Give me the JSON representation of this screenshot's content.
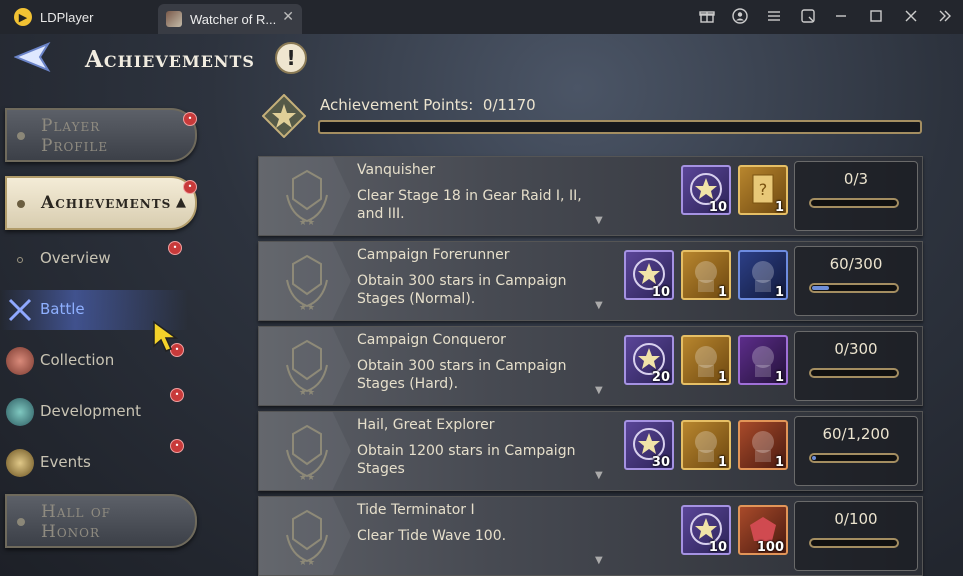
{
  "window": {
    "app_name": "LDPlayer",
    "tab_title": "Watcher of R...",
    "controls": [
      "gift-icon",
      "account-icon",
      "menu-icon",
      "screenshot-icon",
      "minimize-icon",
      "maximize-icon",
      "close-icon",
      "collapse-icon"
    ]
  },
  "header": {
    "title": "Achievements",
    "info_symbol": "!"
  },
  "sidebar": {
    "player_profile": "Player Profile",
    "achievements": "Achievements",
    "achievements_arrow": "▲",
    "subitems": [
      {
        "label": "Overview"
      },
      {
        "label": "Battle"
      },
      {
        "label": "Collection"
      },
      {
        "label": "Development"
      },
      {
        "label": "Events"
      }
    ],
    "hall_of_honor": "Hall of Honor"
  },
  "points": {
    "label": "Achievement Points:",
    "value": "0/1170"
  },
  "achievements": [
    {
      "title": "Vanquisher",
      "desc": "Clear Stage 18 in Gear Raid I, II, and III.",
      "progress": "0/3",
      "fraction": 0,
      "rewards": [
        {
          "type": "achievement-points-icon",
          "color": "purple",
          "qty": "10"
        },
        {
          "type": "mystery-card-icon",
          "color": "gold",
          "qty": "1"
        }
      ]
    },
    {
      "title": "Campaign Forerunner",
      "desc": "Obtain 300 stars in Campaign Stages (Normal).",
      "progress": "60/300",
      "fraction": 0.2,
      "rewards": [
        {
          "type": "achievement-points-icon",
          "color": "purple",
          "qty": "10"
        },
        {
          "type": "golden-hero-icon",
          "color": "gold",
          "qty": "1"
        },
        {
          "type": "dark-warrior-icon",
          "color": "blue",
          "qty": "1"
        }
      ]
    },
    {
      "title": "Campaign Conqueror",
      "desc": "Obtain 300 stars in Campaign Stages (Hard).",
      "progress": "0/300",
      "fraction": 0,
      "rewards": [
        {
          "type": "achievement-points-icon",
          "color": "purple",
          "qty": "20"
        },
        {
          "type": "golden-hero-icon",
          "color": "gold",
          "qty": "1"
        },
        {
          "type": "dark-armor-icon",
          "color": "violet",
          "qty": "1"
        }
      ]
    },
    {
      "title": "Hail, Great Explorer",
      "desc": "Obtain 1200 stars in Campaign Stages",
      "progress": "60/1,200",
      "fraction": 0.05,
      "rewards": [
        {
          "type": "achievement-points-icon",
          "color": "purple",
          "qty": "30"
        },
        {
          "type": "golden-relic-icon",
          "color": "gold",
          "qty": "1"
        },
        {
          "type": "crimson-demon-icon",
          "color": "red",
          "qty": "1"
        }
      ]
    },
    {
      "title": "Tide Terminator I",
      "desc": "Clear Tide Wave 100.",
      "progress": "0/100",
      "fraction": 0,
      "rewards": [
        {
          "type": "achievement-points-icon",
          "color": "purple",
          "qty": "10"
        },
        {
          "type": "red-gem-icon",
          "color": "red",
          "qty": "100"
        }
      ]
    }
  ]
}
